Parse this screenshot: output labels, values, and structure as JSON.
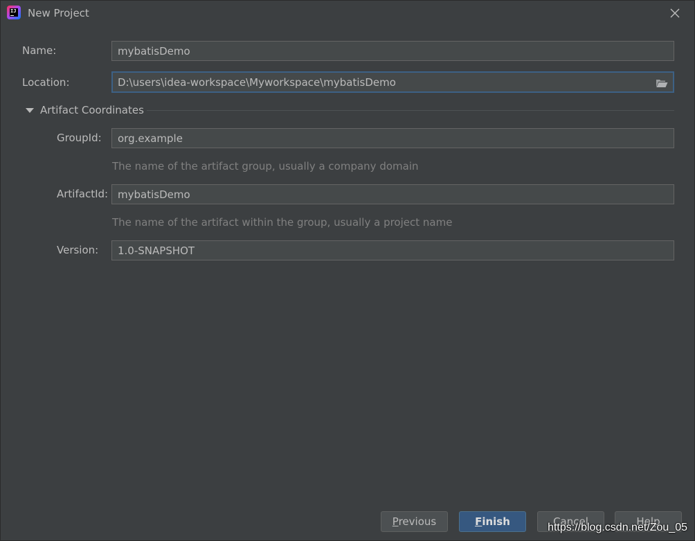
{
  "window": {
    "title": "New Project"
  },
  "form": {
    "name_label": "Name:",
    "name_value": "mybatisDemo",
    "location_label": "Location:",
    "location_value": "D:\\users\\idea-workspace\\Myworkspace\\mybatisDemo",
    "section_title": "Artifact Coordinates",
    "group_label": "GroupId:",
    "group_value": "org.example",
    "group_hint": "The name of the artifact group, usually a company domain",
    "artifact_label": "ArtifactId:",
    "artifact_value": "mybatisDemo",
    "artifact_hint": "The name of the artifact within the group, usually a project name",
    "version_label": "Version:",
    "version_value": "1.0-SNAPSHOT"
  },
  "buttons": {
    "previous": {
      "mnemonic": "P",
      "rest": "revious"
    },
    "finish": {
      "mnemonic": "F",
      "rest": "inish"
    },
    "cancel": "Cancel",
    "help": "Help"
  },
  "watermark": "https://blog.csdn.net/Zou_05",
  "colors": {
    "background": "#3c3f41",
    "field_background": "#45494a",
    "focus_border": "#3d6185",
    "primary_button": "#365880",
    "text": "#bbbbbb",
    "hint_text": "#808080"
  },
  "icons": {
    "app": "intellij-idea-icon",
    "close": "close-icon",
    "folder": "folder-open-icon",
    "expand": "triangle-down-icon"
  }
}
